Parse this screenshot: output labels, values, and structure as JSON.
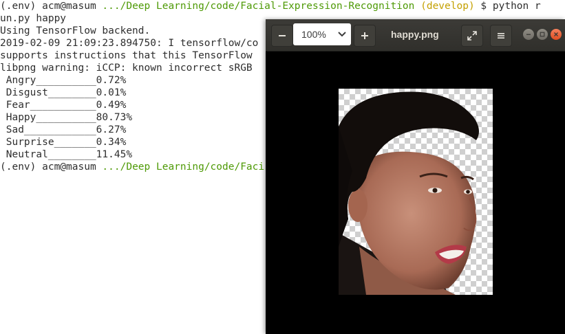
{
  "terminal": {
    "prompt_user": "(.env) acm@masum",
    "prompt_path": ".../Deep Learning/code/Facial-Expression-Recognition",
    "prompt_branch": "(develop)",
    "command_1": " $ python r",
    "command_1_wrap": "un.py happy",
    "line_backend": "Using TensorFlow backend.",
    "line_log": "2019-02-09 21:09:23.894750: I tensorflow/co",
    "line_supports": "supports instructions that this TensorFlow",
    "line_libpng": "libpng warning: iCCP: known incorrect sRGB",
    "results": [
      " Angry__________0.72%",
      " Disgust________0.01%",
      " Fear___________0.49%",
      " Happy__________80.73%",
      " Sad____________6.27%",
      " Surprise_______0.34%",
      " Neutral________11.45%"
    ],
    "prompt2_path": ".../Deep Learning/code/Faci"
  },
  "viewer": {
    "zoom_value": "100%",
    "title": "happy.png"
  }
}
